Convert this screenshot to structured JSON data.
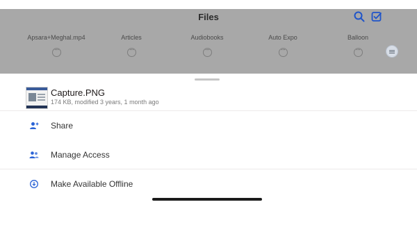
{
  "topbar": {
    "title": "Files"
  },
  "folders": [
    {
      "name": "Apsara+Meghal.mp4"
    },
    {
      "name": "Articles"
    },
    {
      "name": "Audiobooks"
    },
    {
      "name": "Auto Expo"
    },
    {
      "name": "Balloon"
    }
  ],
  "file": {
    "name": "Capture.PNG",
    "meta": "174 KB, modified 3 years, 1 month ago"
  },
  "actions": [
    {
      "label": "Share",
      "icon": "add-person-icon"
    },
    {
      "label": "Manage Access",
      "icon": "people-icon"
    },
    {
      "label": "Make Available Offline",
      "icon": "offline-icon"
    }
  ],
  "colors": {
    "accent": "#0061fe",
    "dim_overlay": "#a8a8a8"
  }
}
